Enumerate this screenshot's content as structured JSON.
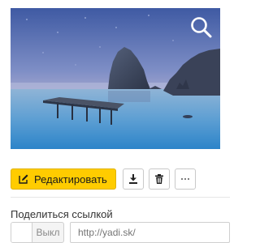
{
  "preview": {
    "image_subject": "seascape with rocky cliff and wooden pier at dusk",
    "zoom_icon": "magnifier-icon"
  },
  "toolbar": {
    "edit_label": "Редактировать",
    "edit_icon": "pencil-edit-icon",
    "download_icon": "download-icon",
    "delete_icon": "trash-icon",
    "more_icon": "more-dots-icon",
    "accent_color": "#ffcc00"
  },
  "share": {
    "label": "Поделиться ссылкой",
    "toggle_state": "Выкл",
    "link_placeholder": "http://yadi.sk/"
  }
}
